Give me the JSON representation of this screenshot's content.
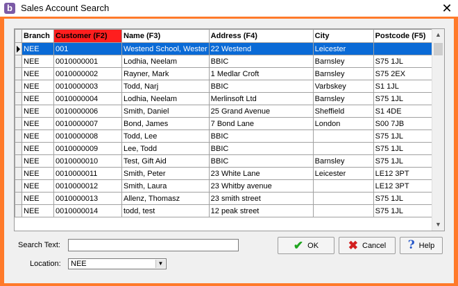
{
  "window": {
    "title": "Sales Account Search",
    "icon_letter": "b"
  },
  "grid": {
    "columns": [
      "Branch",
      "Customer (F2)",
      "Name (F3)",
      "Address (F4)",
      "City",
      "Postcode (F5)"
    ],
    "sorted_column": "Customer (F2)",
    "selected_row": 0,
    "rows": [
      [
        "NEE",
        "001",
        "Westend School, Wester",
        "22 Westend",
        "Leicester",
        ""
      ],
      [
        "NEE",
        "0010000001",
        "Lodhia, Neelam",
        "BBIC",
        "Barnsley",
        "S75 1JL"
      ],
      [
        "NEE",
        "0010000002",
        "Rayner, Mark",
        "1 Medlar Croft",
        "Barnsley",
        "S75 2EX"
      ],
      [
        "NEE",
        "0010000003",
        "Todd, Narj",
        "BBIC",
        "Varbskey",
        "S1 1JL"
      ],
      [
        "NEE",
        "0010000004",
        "Lodhia, Neelam",
        "Merlinsoft Ltd",
        "Barnsley",
        "S75 1JL"
      ],
      [
        "NEE",
        "0010000006",
        "Smith, Daniel",
        "25 Grand Avenue",
        "Sheffield",
        "S1 4DE"
      ],
      [
        "NEE",
        "0010000007",
        "Bond, James",
        "7 Bond Lane",
        "London",
        "S00 7JB"
      ],
      [
        "NEE",
        "0010000008",
        "Todd, Lee",
        "BBIC",
        "",
        "S75 1JL"
      ],
      [
        "NEE",
        "0010000009",
        "Lee, Todd",
        "BBIC",
        "",
        "S75 1JL"
      ],
      [
        "NEE",
        "0010000010",
        "Test, Gift Aid",
        "BBIC",
        "Barnsley",
        "S75 1JL"
      ],
      [
        "NEE",
        "0010000011",
        "Smith, Peter",
        "23 White Lane",
        "Leicester",
        "LE12 3PT"
      ],
      [
        "NEE",
        "0010000012",
        "Smith, Laura",
        "23 Whitby avenue",
        "",
        "LE12 3PT"
      ],
      [
        "NEE",
        "0010000013",
        "Allenz, Thomasz",
        "23 smith street",
        "",
        "S75 1JL"
      ],
      [
        "NEE",
        "0010000014",
        "todd, test",
        "12 peak street",
        "",
        "S75 1JL"
      ]
    ]
  },
  "search": {
    "label": "Search Text:",
    "value": ""
  },
  "location": {
    "label": "Location:",
    "value": "NEE"
  },
  "buttons": {
    "ok": "OK",
    "cancel": "Cancel",
    "help": "Help"
  },
  "icons": {
    "close": "close-icon",
    "ok": "check-icon",
    "cancel": "x-icon",
    "help": "question-icon"
  },
  "colors": {
    "frame": "#ff7a2a",
    "sorted_header": "#ff1e1e",
    "selection": "#0a6ad6"
  }
}
